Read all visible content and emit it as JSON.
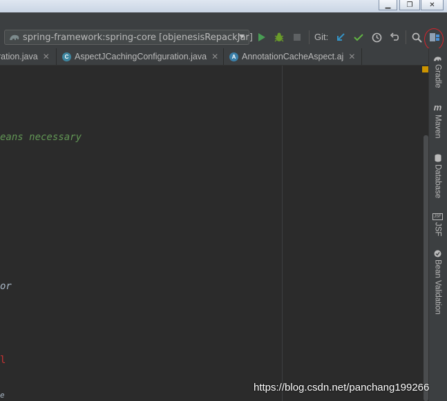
{
  "window": {
    "minimize_glyph": "▁",
    "maximize_glyph": "❐",
    "close_glyph": "✕"
  },
  "toolbar": {
    "run_config": "spring-framework:spring-core [objenesisRepackJar]",
    "git_label": "Git:"
  },
  "tabs": [
    {
      "label": "ration.java",
      "icon": ""
    },
    {
      "label": "AspectJCachingConfiguration.java",
      "icon": "C"
    },
    {
      "label": "AnnotationCacheAspect.aj",
      "icon": "A"
    }
  ],
  "code": {
    "line1": "eans necessary",
    "line2": "or",
    "line3": "l",
    "line4": "e"
  },
  "sidebar": {
    "gradle": "Gradle",
    "maven": "Maven",
    "maven_icon": "m",
    "database": "Database",
    "jsf": "JSF",
    "jsf_icon": "JSF",
    "bean_validation": "Bean Validation"
  },
  "watermark": "https://blog.csdn.net/panchang199266",
  "colors": {
    "run": "#499c54",
    "debug": "#6a9b2a",
    "git_update": "#3592c4",
    "git_commit": "#62b543",
    "comment_green": "#629755",
    "italic_code": "#a9b7c6"
  }
}
